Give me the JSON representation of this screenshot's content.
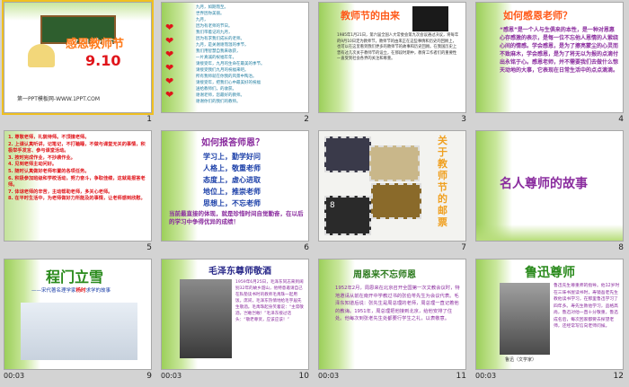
{
  "slides": [
    {
      "num": "1",
      "title": "感恩教师节",
      "date": "9.10",
      "footer": "第一PPT模板网-WWW.1PPT.COM"
    },
    {
      "num": "2",
      "poem": [
        "九月，如期而至。",
        "世界因你美丽。",
        "九月，",
        "因为有老师的节日。",
        "我们带着记的九月，",
        "因为有求我们成长的老师。",
        "九月，是关谢谢而温的季节，",
        "我们用智慧自我来收获，",
        "一片真诚的祝福年年，",
        "请接受年，九月的生命在最美的季节。",
        "请接受我们九月的祝福来吧。",
        "所有我师就在你我的风景中陶冶。",
        "请接受年，把我们心中最美好的祝福",
        "送给教师们，的收获。",
        "谢谢老师，您最好的教师。",
        "谢谢你们的我们的教师。"
      ]
    },
    {
      "num": "3",
      "title": "教师节的由来",
      "body": "1985年1月21日，第六届全国人大常委会第九次会议通过决议，将每年的9月10日定为教师节。教师节的由来正在这些事情和历史的回顾上，也可以在这里看到我们更多的教师节的故事和历史回顾。在我国历史上曾有过几次关于教师节的设立，在那段时期中，教育工作者们的重要性一直受到社会各界的关注和尊重。"
    },
    {
      "num": "4",
      "title": "如何感恩老师？",
      "body": "“感恩”是一个人与生俱来的本性，是一种对恩惠心存感激的表示，是每一位不忘他人恩情的人萦绕心间的情感。学会感恩，是为了擦亮蒙尘的心灵而不致麻木，学会感恩，是为了将无以为报的点滴付出永铭于心。感恩老师，并不需要我们去做什么惊天动地的大事，它表现在日常生活中的点点滴滴。"
    },
    {
      "num": "5",
      "items": [
        "1. 尊敬老师，礼貌待师。不顶撞老师。",
        "2. 上课认真听讲，记笔记，不打瞌睡，不做与课堂无关的事情，积极举手发言、参与课堂活动。",
        "3. 按时完成作业，不抄袭作业。",
        "4. 见到老师主动问好。",
        "5. 随时认真做好老师布置的各项任务。",
        "6. 积极参加班级和学校活动，努力奋斗，争取佳绩，这就是报答老师。",
        "7. 体谅老师的辛苦，主动帮助老师，多关心老师。",
        "8. 在平时生活中，为老师做好力所能及的事情，让老师感到欣慰。"
      ]
    },
    {
      "num": "6",
      "title": "如何报答师恩？",
      "lines": [
        "学习上，勤学好问",
        "人格上，敬重老师",
        "态度上，虚心进取",
        "地位上，推崇老师",
        "思想上，不忘老师"
      ],
      "footer": "当前最直接的体现，就是珍惜时间自觉勤奋，在以后的学习中争得优异的成绩！"
    },
    {
      "num": "7",
      "side": "关于教师节的邮票",
      "stamp_labels": [
        "8",
        "8"
      ]
    },
    {
      "num": "8",
      "title": "名人尊师的故事"
    },
    {
      "num": "9",
      "title": "程门立雪",
      "subtitle_pre": "——宋代著名理学家",
      "subtitle_name": "杨时",
      "subtitle_post": "求学的故事"
    },
    {
      "num": "10",
      "title": "毛泽东尊师敬酒",
      "body": "1959年6月25日，毛泽东同志来到阔别32年的故乡韶山，他特意邀请自己在私塾读书时的教师毛禹珠一起用饭。席间，毛泽东热情地给毛宇居先生敬酒。毛禹珠起身笑着说：“主席敬酒，岂敢岂敢！”毛泽东接过话头：“敬老尊贤，应该应该！”"
    },
    {
      "num": "11",
      "title": "周恩来不忘师恩",
      "body": "1952年2月，周恩来在北京召开全国第一次文教会议时，特地邀请从前在南开中学教过书的张伯苓先生为会议代表。毛泽东知道后说：张先生是周总理的老师，周总理一直记着他的教诲。1951年，周总理把他接到北京，给他安排了住处。他每次到张老先生处都要行学生之礼，以表敬意。"
    },
    {
      "num": "12",
      "title": "鲁迅尊师",
      "body": "鲁迅先生尊重师的指导。他12岁时在三味书屋读书时，寿镜吾老先生教他读书学习，在那里鲁迅学习了四年多。寿先生教他学习，品格高尚，鲁迅对他一直十分敬重。鲁迅成名后，每次回家都要去探望老师，还经常写信向老师问候。",
      "caption": "鲁迅（文学家）"
    }
  ],
  "footer_time": "00:03",
  "colors": {
    "selected": "#f0c020",
    "title_purple": "#8a2c9e",
    "red": "#e0141a"
  }
}
